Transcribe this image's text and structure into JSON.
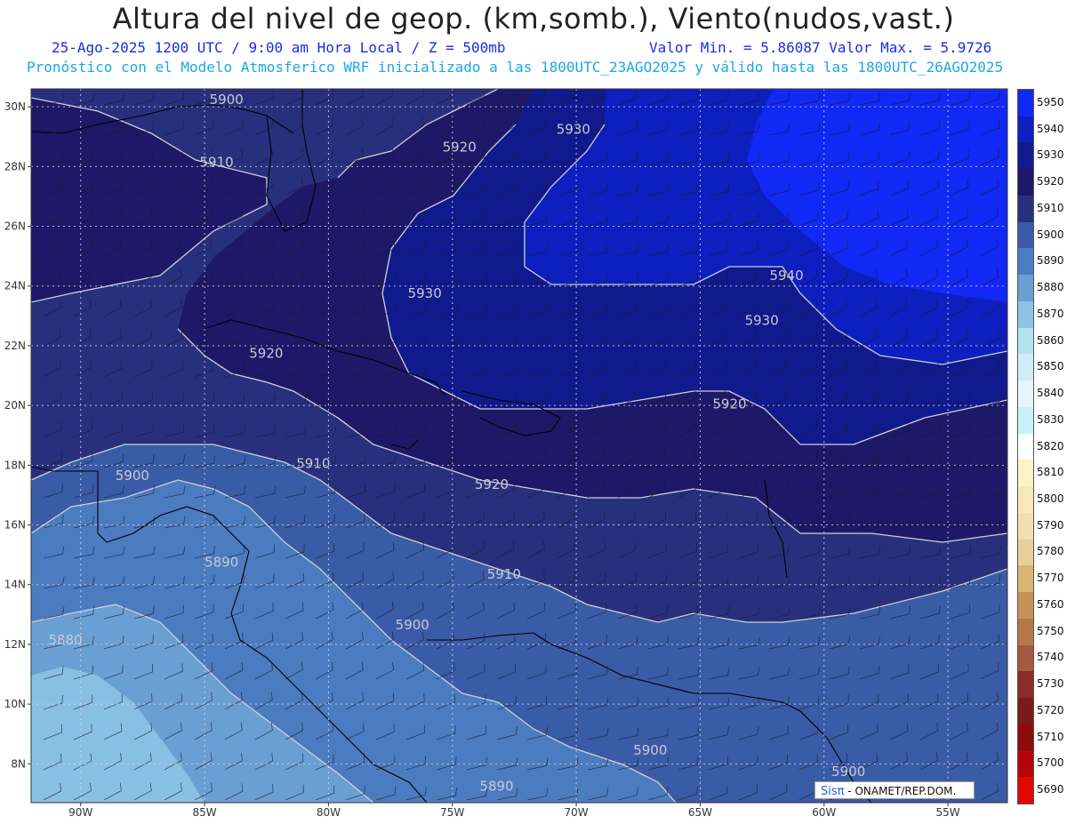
{
  "header": {
    "title": "Altura del nivel de geop. (km,somb.), Viento(nudos,vast.)",
    "datetime_line": "25-Ago-2025  1200 UTC / 9:00 am Hora Local / Z = 500mb",
    "minmax_line": "Valor Min. = 5.86087  Valor Max. = 5.9726",
    "model_line": "Pronóstico con el Modelo Atmosferico WRF inicializado a las 1800UTC_23AGO2025 y válido hasta las  1800UTC_26AGO2025"
  },
  "axes": {
    "lon_labels": [
      "90W",
      "85W",
      "80W",
      "75W",
      "70W",
      "65W",
      "60W",
      "55W"
    ],
    "lat_labels": [
      "30N",
      "28N",
      "26N",
      "24N",
      "22N",
      "20N",
      "18N",
      "16N",
      "14N",
      "12N",
      "10N",
      "8N"
    ]
  },
  "contour_labels": [
    {
      "text": "5900",
      "lon": -84.8,
      "lat": 30.1
    },
    {
      "text": "5910",
      "lon": -85.2,
      "lat": 28.0
    },
    {
      "text": "5920",
      "lon": -75.4,
      "lat": 28.5
    },
    {
      "text": "5930",
      "lon": -70.8,
      "lat": 29.1
    },
    {
      "text": "5930",
      "lon": -76.8,
      "lat": 23.6
    },
    {
      "text": "5940",
      "lon": -62.2,
      "lat": 24.2
    },
    {
      "text": "5930",
      "lon": -63.2,
      "lat": 22.7
    },
    {
      "text": "5920",
      "lon": -83.2,
      "lat": 21.6
    },
    {
      "text": "5920",
      "lon": -64.5,
      "lat": 19.9
    },
    {
      "text": "5920",
      "lon": -74.1,
      "lat": 17.2
    },
    {
      "text": "5910",
      "lon": -81.3,
      "lat": 17.9
    },
    {
      "text": "5900",
      "lon": -88.6,
      "lat": 17.5
    },
    {
      "text": "5910",
      "lon": -73.6,
      "lat": 14.2
    },
    {
      "text": "5890",
      "lon": -85.0,
      "lat": 14.6
    },
    {
      "text": "5900",
      "lon": -77.3,
      "lat": 12.5
    },
    {
      "text": "5880",
      "lon": -91.3,
      "lat": 12.0
    },
    {
      "text": "5900",
      "lon": -67.7,
      "lat": 8.3
    },
    {
      "text": "5900",
      "lon": -59.7,
      "lat": 7.6
    },
    {
      "text": "5890",
      "lon": -73.9,
      "lat": 7.1
    }
  ],
  "colorbar": {
    "levels": [
      "5950",
      "5940",
      "5930",
      "5920",
      "5910",
      "5900",
      "5890",
      "5880",
      "5870",
      "5860",
      "5850",
      "5840",
      "5830",
      "5820",
      "5810",
      "5800",
      "5790",
      "5780",
      "5770",
      "5760",
      "5750",
      "5740",
      "5730",
      "5720",
      "5710",
      "5700",
      "5690"
    ],
    "colors": [
      "#1228f5",
      "#0d1fbe",
      "#101a8c",
      "#1d1868",
      "#28307e",
      "#3a5ba6",
      "#4b7cc0",
      "#6a9fd3",
      "#8cc3e4",
      "#b3e2f1",
      "#cdeef7",
      "#e4f6fb",
      "#c9f0f8",
      "#ffffff",
      "#fbf2c8",
      "#f6e8b8",
      "#f1dfae",
      "#e8cf97",
      "#d9b577",
      "#c6925a",
      "#b6774b",
      "#a45a3c",
      "#8a2d27",
      "#7a1a1a",
      "#8e0b0b",
      "#b40606",
      "#e40505"
    ]
  },
  "credit": {
    "brand": "Sisπ",
    "text": "- ONAMET/REP.DOM."
  }
}
